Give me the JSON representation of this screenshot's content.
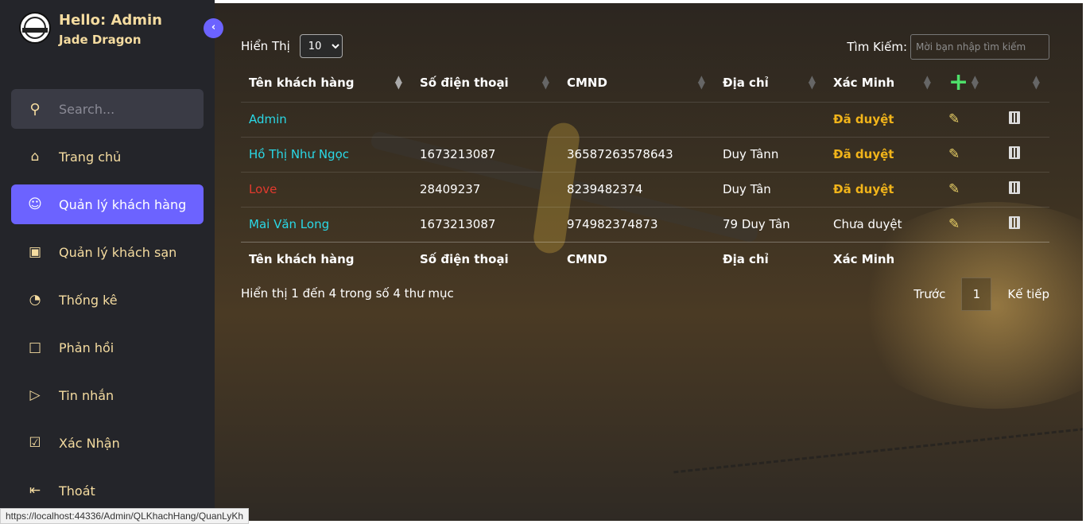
{
  "profile": {
    "hello": "Hello: Admin",
    "brand": "Jade Dragon"
  },
  "sidebar_toggle": "‹",
  "search": {
    "placeholder": "Search..."
  },
  "nav": [
    {
      "label": "Trang chủ",
      "icon": "home-icon"
    },
    {
      "label": "Quản lý khách hàng",
      "icon": "user-x-icon",
      "active": true
    },
    {
      "label": "Quản lý khách sạn",
      "icon": "monitor-icon"
    },
    {
      "label": "Thống kê",
      "icon": "pie-chart-icon"
    },
    {
      "label": "Phản hồi",
      "icon": "message-square-icon"
    },
    {
      "label": "Tin nhắn",
      "icon": "send-icon"
    },
    {
      "label": "Xác Nhận",
      "icon": "check-square-icon"
    },
    {
      "label": "Thoát",
      "icon": "log-out-icon"
    }
  ],
  "controls": {
    "show_label": "Hiển Thị",
    "page_size": "10",
    "search_label": "Tìm Kiếm:",
    "search_placeholder": "Mời bạn nhập tìm kiếm"
  },
  "table": {
    "headers": [
      "Tên khách hàng",
      "Số điện thoại",
      "CMND",
      "Địa chỉ",
      "Xác Minh"
    ],
    "rows": [
      {
        "name": "Admin",
        "phone": "",
        "cmnd": "",
        "address": "",
        "status": "Đã duyệt"
      },
      {
        "name": "Hồ Thị Như Ngọc",
        "phone": "1673213087",
        "cmnd": "36587263578643",
        "address": "Duy Tânn",
        "status": "Đã duyệt"
      },
      {
        "name": "Love",
        "phone": "28409237",
        "cmnd": "8239482374",
        "address": "Duy Tân",
        "status": "Đã duyệt"
      },
      {
        "name": "Mai Văn Long",
        "phone": "1673213087",
        "cmnd": "974982374873",
        "address": "79 Duy Tân",
        "status": "Chưa duyệt"
      }
    ]
  },
  "footer": {
    "info": "Hiển thị 1 đến 4 trong số 4 thư mục",
    "prev": "Trước",
    "page": "1",
    "next": "Kế tiếp"
  },
  "status_url": "https://localhost:44336/Admin/QLKhachHang/QuanLyKh",
  "colors": {
    "accent": "#6c63ff",
    "sidebar": "#24252a",
    "approved": "#f1b41a",
    "add": "#4ee06a"
  }
}
